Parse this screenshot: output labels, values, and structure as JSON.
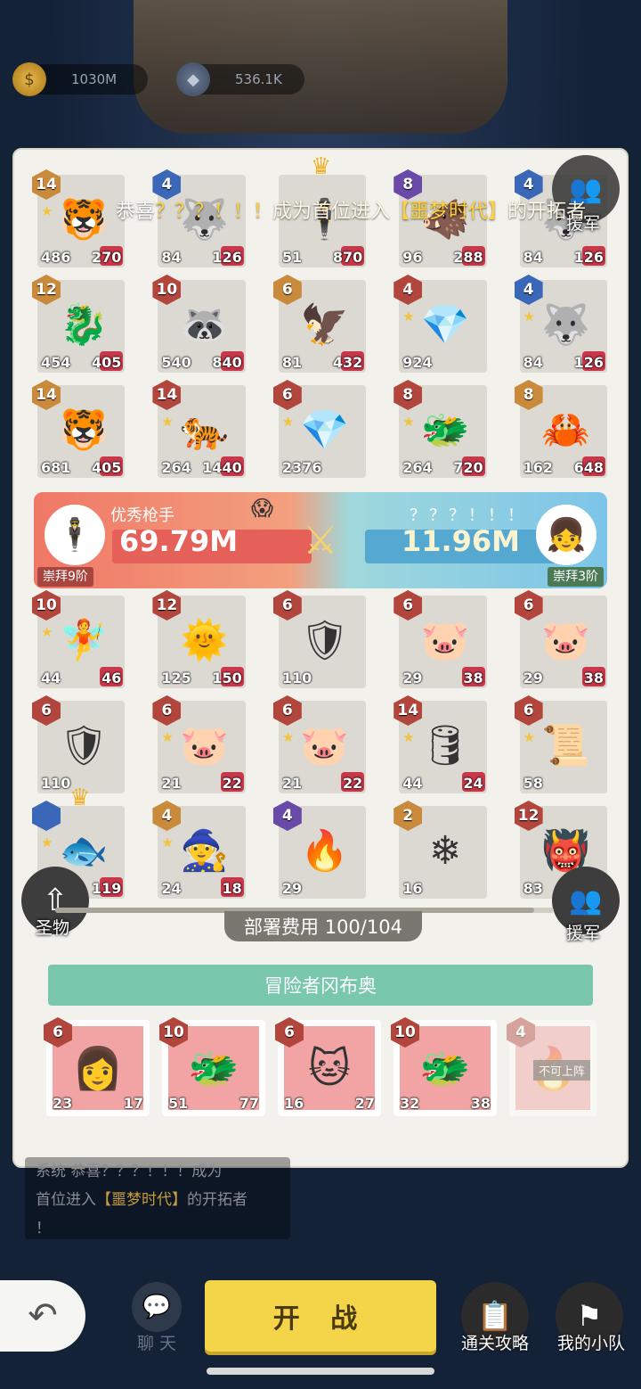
{
  "resources": {
    "gold": "1030M",
    "gems": "536.1K"
  },
  "marquee": {
    "prefix": "恭喜",
    "who": "？？？！！！",
    "mid": "成为首位进入",
    "place": "【噩梦时代】",
    "suffix": "的开拓者"
  },
  "aid_label": "援军",
  "enemy_grid": [
    [
      {
        "lvl": "14",
        "atk": "486",
        "hp": "270",
        "color": "orange",
        "icon": "tiger-icon",
        "star": true
      },
      {
        "lvl": "4",
        "atk": "84",
        "hp": "126",
        "color": "blue",
        "icon": "wolf-icon",
        "star": false
      },
      {
        "lvl": "",
        "atk": "51",
        "hp": "870",
        "color": "none",
        "icon": "gunman-icon",
        "star": false,
        "crown": true
      },
      {
        "lvl": "8",
        "atk": "96",
        "hp": "288",
        "color": "purple",
        "icon": "beast-icon",
        "star": false
      },
      {
        "lvl": "4",
        "atk": "84",
        "hp": "126",
        "color": "blue",
        "icon": "wolf-icon",
        "star": false
      }
    ],
    [
      {
        "lvl": "12",
        "atk": "454",
        "hp": "405",
        "color": "orange",
        "icon": "fire-dragon-icon",
        "star": false
      },
      {
        "lvl": "10",
        "atk": "540",
        "hp": "840",
        "color": "red",
        "icon": "raccoon-icon",
        "star": false
      },
      {
        "lvl": "6",
        "atk": "81",
        "hp": "432",
        "color": "orange",
        "icon": "bird-icon",
        "star": false
      },
      {
        "lvl": "4",
        "atk": "924",
        "hp": "",
        "color": "red",
        "icon": "crystal-icon",
        "star": true
      },
      {
        "lvl": "4",
        "atk": "84",
        "hp": "126",
        "color": "blue",
        "icon": "wolf-icon",
        "star": true
      }
    ],
    [
      {
        "lvl": "14",
        "atk": "681",
        "hp": "405",
        "color": "orange",
        "icon": "tiger-icon",
        "star": false
      },
      {
        "lvl": "14",
        "atk": "264",
        "hp": "1440",
        "color": "red",
        "icon": "tiger-axe-icon",
        "star": true
      },
      {
        "lvl": "6",
        "atk": "2376",
        "hp": "",
        "color": "red",
        "icon": "crystal-icon",
        "star": true
      },
      {
        "lvl": "8",
        "atk": "264",
        "hp": "720",
        "color": "red",
        "icon": "dragon-icon",
        "star": true
      },
      {
        "lvl": "8",
        "atk": "162",
        "hp": "648",
        "color": "orange",
        "icon": "crab-icon",
        "star": false
      }
    ]
  ],
  "battle": {
    "left_name": "优秀枪手",
    "left_power": "69.79M",
    "left_worship": "崇拜9阶",
    "right_name": "？？？！！！",
    "right_power": "11.96M",
    "right_worship": "崇拜3阶"
  },
  "player_grid": [
    [
      {
        "lvl": "10",
        "atk": "44",
        "hp": "46",
        "color": "red",
        "icon": "girl-icon",
        "star": true
      },
      {
        "lvl": "12",
        "atk": "125",
        "hp": "150",
        "color": "red",
        "icon": "sun-icon",
        "star": false
      },
      {
        "lvl": "6",
        "atk": "110",
        "hp": "",
        "color": "red",
        "icon": "shield-stone-icon",
        "star": false
      },
      {
        "lvl": "6",
        "atk": "29",
        "hp": "38",
        "color": "red",
        "icon": "pig-icon",
        "star": false
      },
      {
        "lvl": "6",
        "atk": "29",
        "hp": "38",
        "color": "red",
        "icon": "pig-icon",
        "star": false
      }
    ],
    [
      {
        "lvl": "6",
        "atk": "110",
        "hp": "",
        "color": "red",
        "icon": "shield-stone-icon",
        "star": false
      },
      {
        "lvl": "6",
        "atk": "21",
        "hp": "22",
        "color": "red",
        "icon": "pig-icon",
        "star": true
      },
      {
        "lvl": "6",
        "atk": "21",
        "hp": "22",
        "color": "red",
        "icon": "pig-icon",
        "star": true
      },
      {
        "lvl": "14",
        "atk": "44",
        "hp": "24",
        "color": "red",
        "icon": "barrel-icon",
        "star": true
      },
      {
        "lvl": "6",
        "atk": "58",
        "hp": "",
        "color": "red",
        "icon": "scroll-icon",
        "star": true
      }
    ],
    [
      {
        "lvl": "",
        "atk": "",
        "hp": "119",
        "color": "blue",
        "icon": "fish-icon",
        "star": true,
        "crown": true
      },
      {
        "lvl": "4",
        "atk": "24",
        "hp": "18",
        "color": "orange",
        "icon": "wizard-icon",
        "star": true
      },
      {
        "lvl": "4",
        "atk": "29",
        "hp": "",
        "color": "purple",
        "icon": "fire-stone-icon",
        "star": false
      },
      {
        "lvl": "2",
        "atk": "16",
        "hp": "",
        "color": "orange",
        "icon": "ice-stone-icon",
        "star": false
      },
      {
        "lvl": "12",
        "atk": "83",
        "hp": "",
        "color": "red",
        "icon": "viking-icon",
        "star": false
      }
    ]
  ],
  "relic_label": "圣物",
  "deploy_cost": "部署费用 100/104",
  "deploy_ratio": 0.96,
  "adventurer": "冒险者冈布奥",
  "reserve": [
    {
      "lvl": "6",
      "atk": "23",
      "hp": "17",
      "icon": "girl-photo-icon"
    },
    {
      "lvl": "10",
      "atk": "51",
      "hp": "77",
      "icon": "green-dragon-icon"
    },
    {
      "lvl": "6",
      "atk": "16",
      "hp": "27",
      "icon": "cat-icon"
    },
    {
      "lvl": "10",
      "atk": "32",
      "hp": "38",
      "icon": "green-dragon-icon"
    },
    {
      "lvl": "4",
      "atk": "",
      "hp": "",
      "icon": "fire-stone-icon",
      "ban": "不可上阵"
    }
  ],
  "chatlog": {
    "line1": "系统  恭喜？？？！！！成为",
    "line2": "首位进入",
    "line2_hl": "【噩梦时代】",
    "line2_tail": "的开拓者",
    "line3": "！"
  },
  "buttons": {
    "chat": "聊 天",
    "start": "开 战",
    "guide": "通关攻略",
    "team": "我的小队"
  }
}
